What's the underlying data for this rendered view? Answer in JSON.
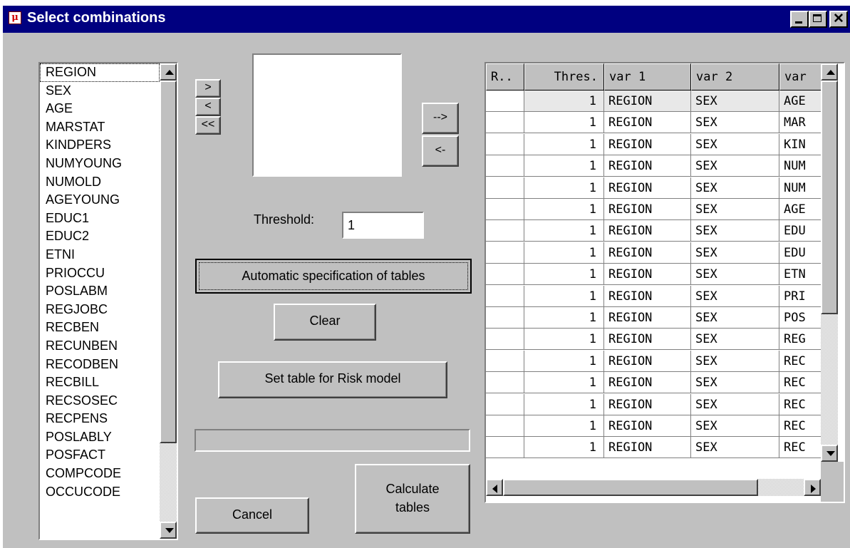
{
  "window": {
    "title": "Select combinations",
    "app_icon": "mu-argus-icon",
    "controls": [
      "minimize-icon",
      "maximize-icon",
      "close-icon"
    ]
  },
  "variables": [
    "REGION",
    "SEX",
    "AGE",
    "MARSTAT",
    "KINDPERS",
    "NUMYOUNG",
    "NUMOLD",
    "AGEYOUNG",
    "EDUC1",
    "EDUC2",
    "ETNI",
    "PRIOCCU",
    "POSLABM",
    "REGJOBC",
    "RECBEN",
    "RECUNBEN",
    "RECODBEN",
    "RECBILL",
    "RECSOSEC",
    "RECPENS",
    "POSLABLY",
    "POSFACT",
    "COMPCODE",
    "OCCUCODE"
  ],
  "selected_variable": "REGION",
  "move_buttons": {
    "add": ">",
    "remove": "<",
    "remove_all": "<<"
  },
  "table_buttons": {
    "add": "-->",
    "remove": "<-"
  },
  "threshold": {
    "label": "Threshold:",
    "value": "1"
  },
  "buttons": {
    "automatic": "Automatic specification of tables",
    "clear": "Clear",
    "risk_model": "Set table for Risk model",
    "cancel": "Cancel",
    "calculate_line1": "Calculate",
    "calculate_line2": "tables"
  },
  "progress": {
    "value": 0
  },
  "table": {
    "columns": [
      "R..",
      "Thres.",
      "var 1",
      "var 2",
      "var"
    ],
    "rows": [
      [
        "",
        "1",
        "REGION",
        "SEX",
        "AGE"
      ],
      [
        "",
        "1",
        "REGION",
        "SEX",
        "MAR"
      ],
      [
        "",
        "1",
        "REGION",
        "SEX",
        "KIN"
      ],
      [
        "",
        "1",
        "REGION",
        "SEX",
        "NUM"
      ],
      [
        "",
        "1",
        "REGION",
        "SEX",
        "NUM"
      ],
      [
        "",
        "1",
        "REGION",
        "SEX",
        "AGE"
      ],
      [
        "",
        "1",
        "REGION",
        "SEX",
        "EDU"
      ],
      [
        "",
        "1",
        "REGION",
        "SEX",
        "EDU"
      ],
      [
        "",
        "1",
        "REGION",
        "SEX",
        "ETN"
      ],
      [
        "",
        "1",
        "REGION",
        "SEX",
        "PRI"
      ],
      [
        "",
        "1",
        "REGION",
        "SEX",
        "POS"
      ],
      [
        "",
        "1",
        "REGION",
        "SEX",
        "REG"
      ],
      [
        "",
        "1",
        "REGION",
        "SEX",
        "REC"
      ],
      [
        "",
        "1",
        "REGION",
        "SEX",
        "REC"
      ],
      [
        "",
        "1",
        "REGION",
        "SEX",
        "REC"
      ],
      [
        "",
        "1",
        "REGION",
        "SEX",
        "REC"
      ],
      [
        "",
        "1",
        "REGION",
        "SEX",
        "REC"
      ]
    ]
  }
}
